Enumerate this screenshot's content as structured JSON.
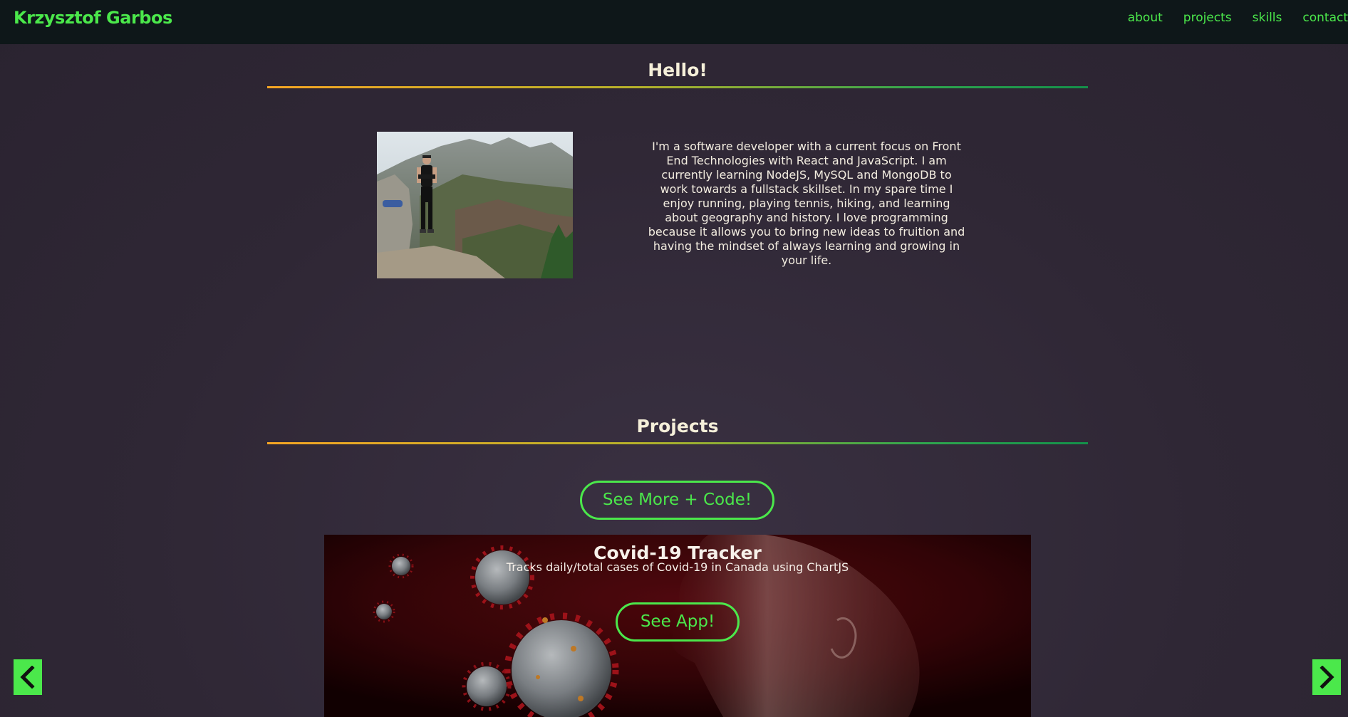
{
  "header": {
    "brand": "Krzysztof Garbos",
    "nav": [
      {
        "label": "about"
      },
      {
        "label": "projects"
      },
      {
        "label": "skills"
      },
      {
        "label": "contact"
      }
    ]
  },
  "hello": {
    "title": "Hello!",
    "bio": "I'm a software developer with a current focus on Front End Technologies with React and JavaScript. I am currently learning NodeJS, MySQL and MongoDB to work towards a fullstack skillset. In my spare time I enjoy running, playing tennis, hiking, and learning about geography and history. I love programming because it allows you to bring new ideas to fruition and having the mindset of always learning and growing in your life."
  },
  "projects": {
    "title": "Projects",
    "see_more_label": "See More + Code!",
    "card": {
      "title": "Covid-19 Tracker",
      "description": "Tracks daily/total cases of Covid-19 in Canada using ChartJS",
      "button_label": "See App!"
    }
  },
  "carousel": {
    "prev_icon": "chevron-left-icon",
    "next_icon": "chevron-right-icon"
  },
  "colors": {
    "accent": "#4be84b",
    "header_bg": "#0e1719",
    "page_bg": "#2f2735",
    "card_bg": "#2a0306"
  }
}
